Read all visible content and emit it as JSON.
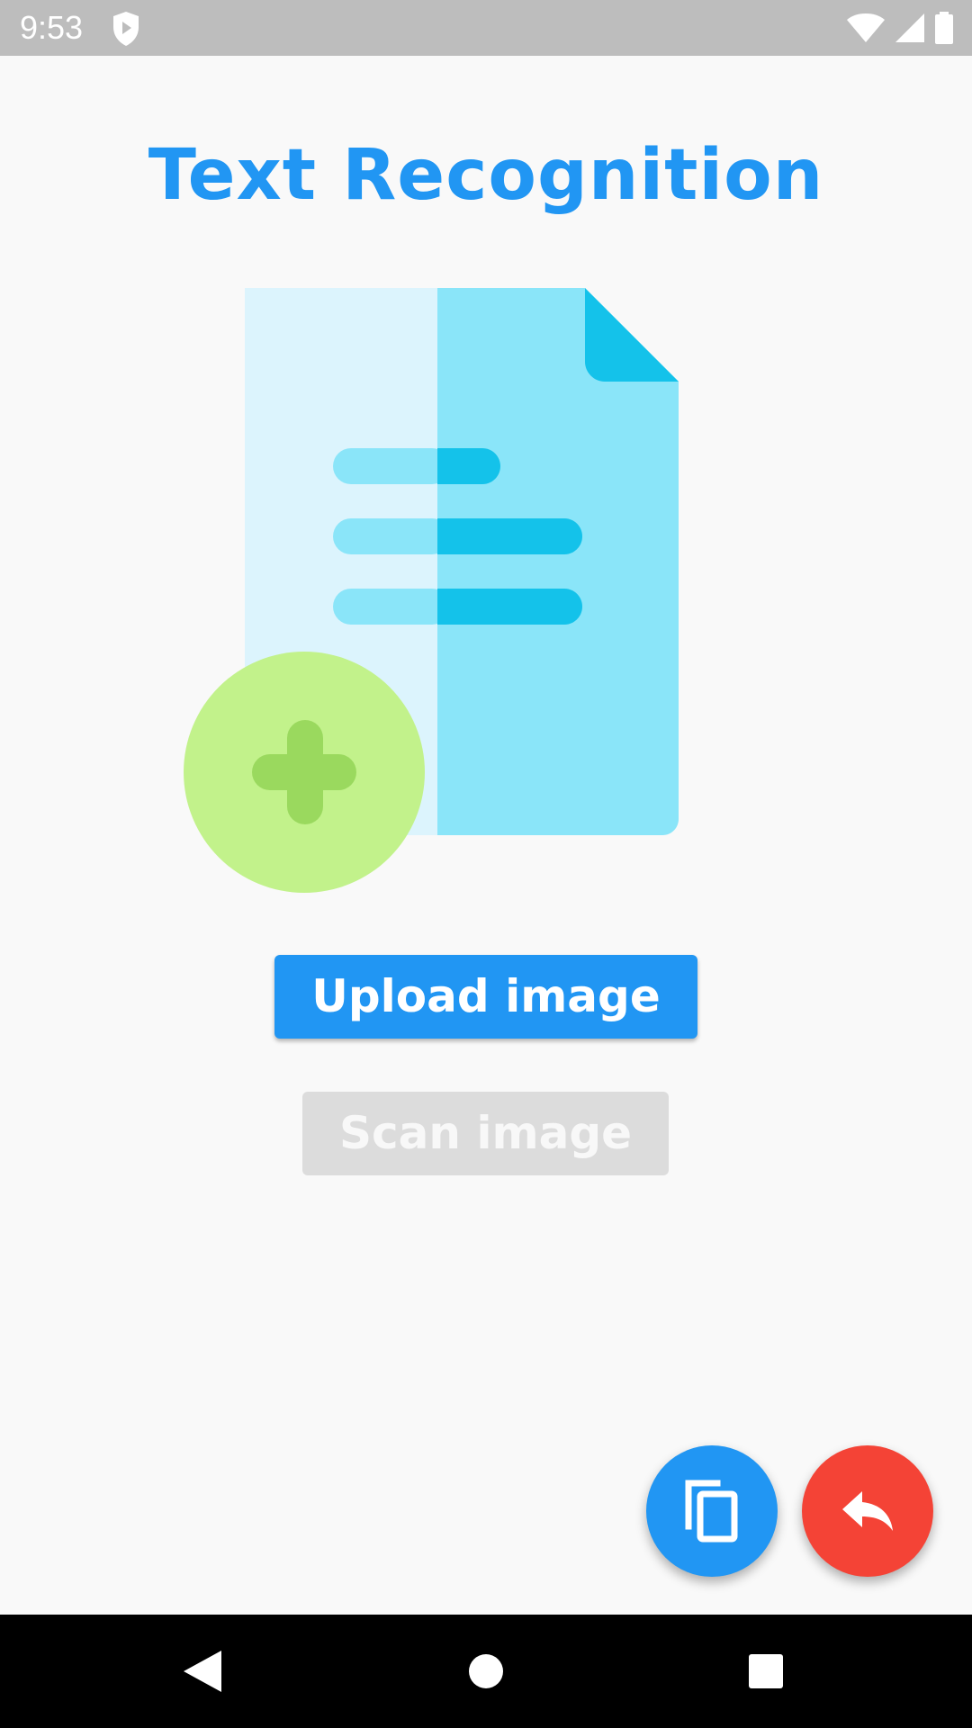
{
  "status_bar": {
    "time": "9:53",
    "icons": [
      "shield-play-icon",
      "wifi-icon",
      "signal-icon",
      "battery-icon"
    ]
  },
  "title": "Text Recognition",
  "illustration": {
    "icon": "add-document-icon",
    "colors": {
      "page_light": "#dcf4fd",
      "page_dark": "#8ae5f9",
      "accent": "#14c2ea",
      "circle": "#c2f28b",
      "plus": "#9ad95e"
    }
  },
  "buttons": {
    "upload_label": "Upload image",
    "scan_label": "Scan image",
    "scan_enabled": false
  },
  "fabs": {
    "copy_icon": "copy-icon",
    "reply_icon": "reply-icon",
    "copy_color": "#2196f3",
    "reply_color": "#f44336"
  },
  "nav_bar": {
    "icons": [
      "back-icon",
      "home-icon",
      "recents-icon"
    ]
  },
  "colors": {
    "primary": "#2196f3",
    "background": "#f9f9f9",
    "status_bar": "#bdbdbd"
  }
}
